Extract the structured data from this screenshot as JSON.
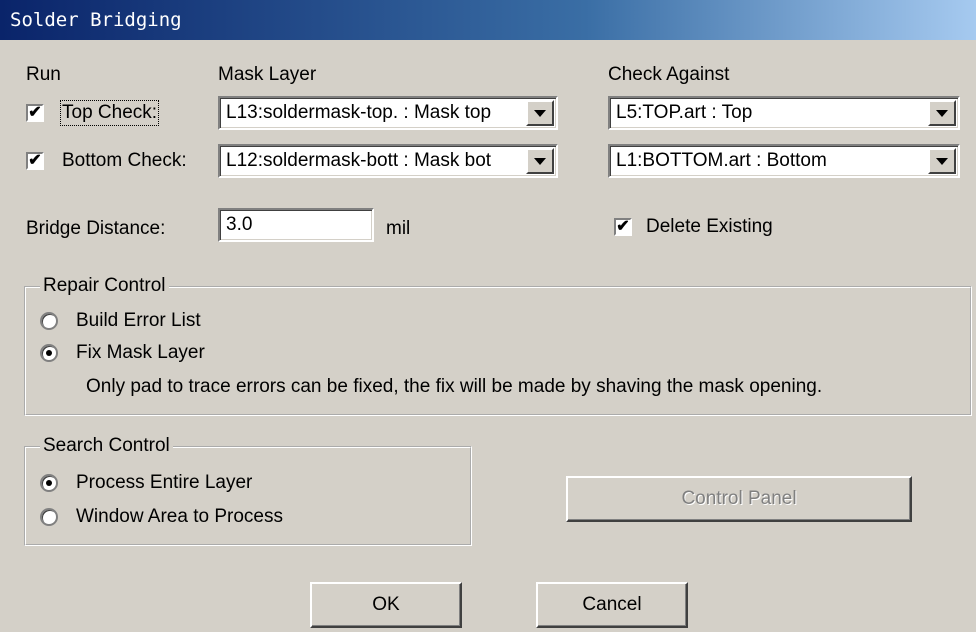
{
  "window": {
    "title": "Solder Bridging"
  },
  "headers": {
    "run": "Run",
    "mask_layer": "Mask Layer",
    "check_against": "Check Against"
  },
  "top": {
    "label": "Top Check:",
    "checked": true,
    "mask": "L13:soldermask-top.  : Mask top",
    "against": "L5:TOP.art  : Top"
  },
  "bottom": {
    "label": "Bottom Check:",
    "checked": true,
    "mask": "L12:soldermask-bott  : Mask bot",
    "against": "L1:BOTTOM.art  : Bottom"
  },
  "bridge": {
    "label": "Bridge Distance:",
    "value": "3.0",
    "unit": "mil"
  },
  "delete_existing": {
    "label": "Delete Existing",
    "checked": true
  },
  "repair": {
    "title": "Repair Control",
    "build_error_list": "Build Error List",
    "fix_mask_layer": "Fix Mask Layer",
    "selected": "fix_mask_layer",
    "note": "Only pad to trace errors can be fixed, the fix will be made by shaving the mask opening."
  },
  "search": {
    "title": "Search Control",
    "entire_layer": "Process Entire Layer",
    "window_area": "Window Area to Process",
    "selected": "entire_layer"
  },
  "buttons": {
    "control_panel": "Control Panel",
    "ok": "OK",
    "cancel": "Cancel"
  },
  "colors": {
    "face": "#d4d0c8",
    "title_start": "#0a246a",
    "title_end": "#a6caf0"
  }
}
